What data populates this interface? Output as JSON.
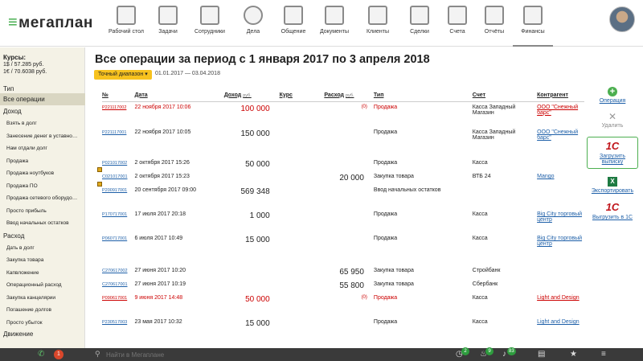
{
  "app": {
    "logo": "мегаплан"
  },
  "nav": [
    {
      "label": "Рабочий стол",
      "icon": "desktop-icon"
    },
    {
      "label": "Задачи",
      "icon": "tasks-icon"
    },
    {
      "label": "Сотрудники",
      "icon": "employees-icon"
    },
    {
      "label": "Дела",
      "icon": "clock-icon"
    },
    {
      "label": "Общение",
      "icon": "chat-icon"
    },
    {
      "label": "Документы",
      "icon": "folder-icon"
    },
    {
      "label": "Клиенты",
      "icon": "clients-icon"
    },
    {
      "label": "Сделки",
      "icon": "deals-icon"
    },
    {
      "label": "Счета",
      "icon": "invoice-icon"
    },
    {
      "label": "Отчёты",
      "icon": "reports-icon"
    },
    {
      "label": "Финансы",
      "icon": "safe-icon"
    }
  ],
  "sidebar": {
    "rates_title": "Курсы:",
    "rate_usd": "1$ / 57.285 руб.",
    "rate_eur": "1€ / 70.6038 руб.",
    "type_header": "Тип",
    "all_ops": "Все операции",
    "income_header": "Доход",
    "income_items": [
      "Взять в долг",
      "Занесение денег в уставной ...",
      "Нам отдали долг",
      "Продажа",
      "Продажа ноутбуков",
      "Продажа ПО",
      "Продажа сетевого оборудов...",
      "Просто прибыль",
      "Ввод начальных остатков"
    ],
    "expense_header": "Расход",
    "expense_items": [
      "Дать в долг",
      "Закупка товара",
      "Капвложение",
      "Операционный расход",
      "Закупка канцелярии",
      "Погашение долгов",
      "Просто убыток"
    ],
    "move_header": "Движение"
  },
  "main": {
    "title": "Все операции за период с 1 января 2017 по 3 апреля 2018",
    "range_button": "Точный диапазон ▾",
    "range_text": "01.01.2017 — 03.04.2018"
  },
  "table": {
    "headers": {
      "num": "№",
      "date": "Дата",
      "income": "Доход",
      "income_unit": "руб.",
      "rate": "Курс",
      "expense": "Расход",
      "expense_unit": "руб.",
      "type": "Тип",
      "account": "Счет",
      "contractor": "Контрагент"
    },
    "rows": [
      {
        "num": "Р221117002",
        "date": "22 ноября 2017 10:06",
        "income": "100 000",
        "expense": "(0)",
        "type": "Продажа",
        "account": "Касса Западный Магазин",
        "contractor": "ООО \"Снежный барс\"",
        "red": true
      },
      {
        "num": "Р221117001",
        "date": "22 ноября 2017 10:05",
        "income": "150 000",
        "expense": "",
        "type": "Продажа",
        "account": "Касса Западный Магазин",
        "contractor": "ООО \"Снежный барс\"",
        "red": false
      },
      {
        "num": "Р021017002",
        "date": "2 октября 2017 15:26",
        "income": "50 000",
        "expense": "",
        "type": "Продажа",
        "account": "Касса",
        "contractor": "",
        "red": false
      },
      {
        "num": "С021017001",
        "date": "2 октября 2017 15:23",
        "income": "",
        "expense": "20 000",
        "type": "Закупка товара",
        "account": "ВТБ 24",
        "contractor": "Mango",
        "red": false
      },
      {
        "num": "Р200917001",
        "date": "20 сентября 2017 09:00",
        "income": "569 348",
        "expense": "",
        "type": "Ввод начальных остатков",
        "account": "",
        "contractor": "",
        "red": false
      },
      {
        "num": "Р170717001",
        "date": "17 июля 2017 20:18",
        "income": "1 000",
        "expense": "",
        "type": "Продажа",
        "account": "Касса",
        "contractor": "Big City торговый центр",
        "red": false
      },
      {
        "num": "Р060717001",
        "date": "6 июля 2017 10:49",
        "income": "15 000",
        "expense": "",
        "type": "Продажа",
        "account": "Касса",
        "contractor": "Big City торговый центр",
        "red": false
      },
      {
        "num": "С270617002",
        "date": "27 июня 2017 10:20",
        "income": "",
        "expense": "65 950",
        "type": "Закупка товара",
        "account": "Стройбанк",
        "contractor": "",
        "red": false
      },
      {
        "num": "С270617001",
        "date": "27 июня 2017 10:19",
        "income": "",
        "expense": "55 800",
        "type": "Закупка товара",
        "account": "Сбербанк",
        "contractor": "",
        "red": false
      },
      {
        "num": "Р090617001",
        "date": "9 июня 2017 14:48",
        "income": "50 000",
        "expense": "(0)",
        "type": "Продажа",
        "account": "Касса",
        "contractor": "Light and Design",
        "red": true
      },
      {
        "num": "Р230517003",
        "date": "23 мая 2017 10:32",
        "income": "15 000",
        "expense": "",
        "type": "Продажа",
        "account": "Касса",
        "contractor": "Light and Design",
        "red": false
      }
    ]
  },
  "actions": {
    "operation": "Операция",
    "delete": "Удалить",
    "load_statement": "Загрузить выписку",
    "export": "Экспортировать",
    "upload_1c": "Выгрузить в 1С",
    "onec_logo": "1С"
  },
  "bottom": {
    "call_badge": "1",
    "search_placeholder": "Найти в Мегаплане",
    "badge_clock": "2",
    "badge_fire": "9",
    "badge_bell": "83"
  }
}
